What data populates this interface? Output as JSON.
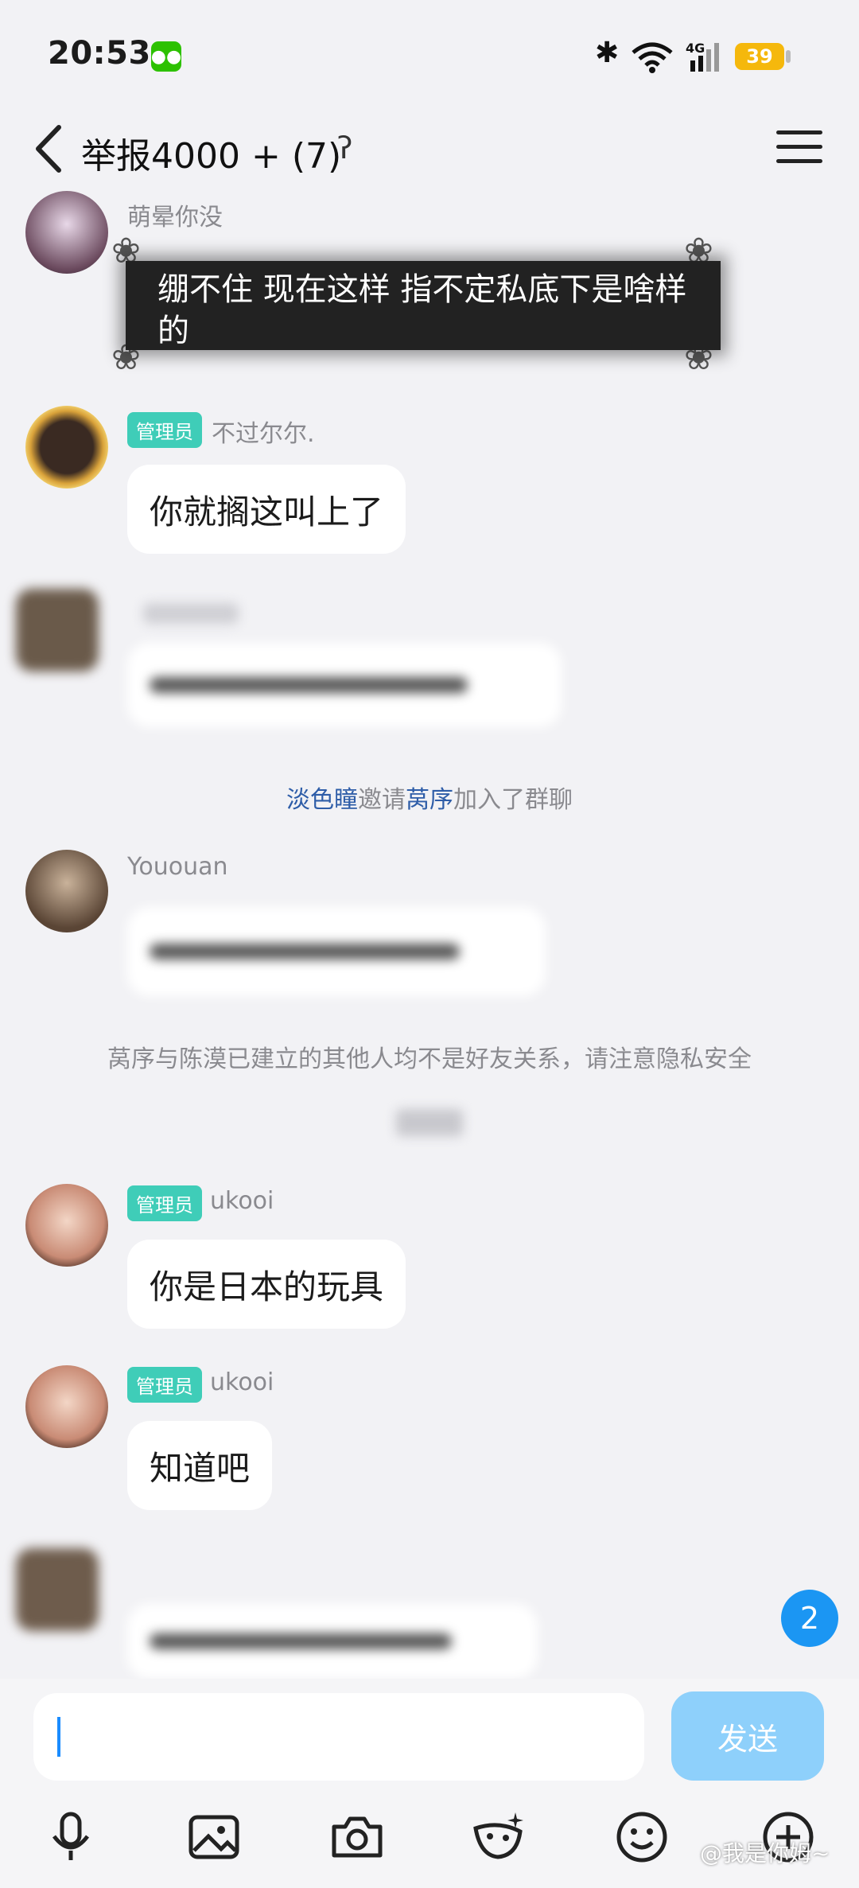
{
  "status_bar": {
    "time": "20:53",
    "network": "4G",
    "battery": "39"
  },
  "header": {
    "title": "举报4000 + (7)"
  },
  "messages": [
    {
      "sender": "萌晕你没",
      "text": "绷不住 现在这样 指不定私底下是啥样的"
    },
    {
      "badge": "管理员",
      "sender": "不过尔尔.",
      "text": "你就搁这叫上了"
    },
    {
      "sender": "",
      "text": ""
    },
    {
      "sender": "Yououan",
      "text": ""
    },
    {
      "badge": "管理员",
      "sender": "ukooi",
      "text": "你是日本的玩具"
    },
    {
      "badge": "管理员",
      "sender": "ukooi",
      "text": "知道吧"
    }
  ],
  "system_notices": {
    "invite": {
      "inviter": "淡色瞳",
      "action": "邀请",
      "invitee": "莴序",
      "suffix": "加入了群聊"
    },
    "privacy": "莴序与陈漠已建立的其他人均不是好友关系，请注意隐私安全"
  },
  "unread_count": "2",
  "composer": {
    "send_label": "发送"
  },
  "watermark": "@我是你姆~",
  "colors": {
    "accent": "#1b96f3",
    "admin_badge": "#3fcdb8",
    "send_disabled": "#8ed0fb",
    "link": "#2e5da8"
  }
}
